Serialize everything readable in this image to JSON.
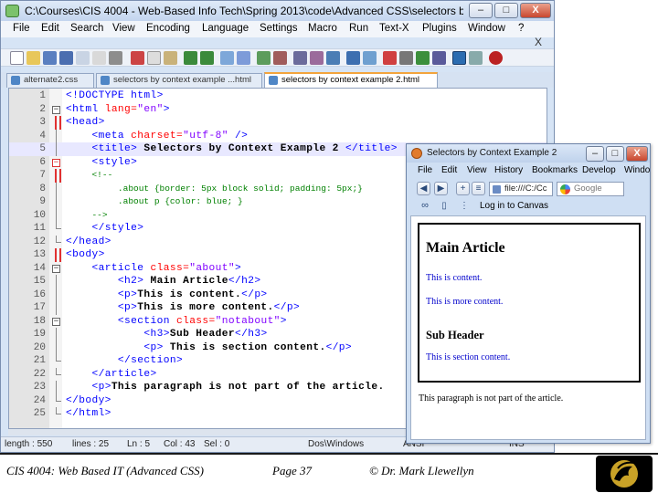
{
  "notepad": {
    "title": "C:\\Courses\\CIS 4004 - Web-Based Info Tech\\Spring 2013\\code\\Advanced CSS\\selectors by con...",
    "window_buttons": {
      "minimize": "–",
      "maximize": "□",
      "close": "X"
    },
    "menu": [
      "File",
      "Edit",
      "Search",
      "View",
      "Encoding",
      "Language",
      "Settings",
      "Macro",
      "Run",
      "Text-X",
      "Plugins",
      "Window",
      "?"
    ],
    "doc_close": "X",
    "tabs": [
      {
        "label": "alternate2.css"
      },
      {
        "label": "selectors by context example ...html"
      },
      {
        "label": "selectors by context example 2.html"
      }
    ],
    "lines": [
      {
        "num": "1"
      },
      {
        "num": "2"
      },
      {
        "num": "3"
      },
      {
        "num": "4"
      },
      {
        "num": "5"
      },
      {
        "num": "6"
      },
      {
        "num": "7"
      },
      {
        "num": "8"
      },
      {
        "num": "9"
      },
      {
        "num": "10"
      },
      {
        "num": "11"
      },
      {
        "num": "12"
      },
      {
        "num": "13"
      },
      {
        "num": "14"
      },
      {
        "num": "15"
      },
      {
        "num": "16"
      },
      {
        "num": "17"
      },
      {
        "num": "18"
      },
      {
        "num": "19"
      },
      {
        "num": "20"
      },
      {
        "num": "21"
      },
      {
        "num": "22"
      },
      {
        "num": "23"
      },
      {
        "num": "24"
      },
      {
        "num": "25"
      }
    ],
    "code": {
      "l1": "<!DOCTYPE html>",
      "l2_tag": "<html",
      "l2_attr": "lang=",
      "l2_str": "\"en\"",
      "l2_end": ">",
      "l3": "<head>",
      "l4_tag": "<meta",
      "l4_attr": "charset=",
      "l4_str": "\"utf-8\"",
      "l4_end": "/>",
      "l5_open": "<title>",
      "l5_text": "Selectors by Context Example 2",
      "l5_close": "</title>",
      "l6": "<style>",
      "l7": "<!--",
      "l8": ".about {border: 5px block solid; padding: 5px;}",
      "l9": ".about p {color: blue; }",
      "l10": "-->",
      "l11": "</style>",
      "l12": "</head>",
      "l13": "<body>",
      "l14_tag": "<article",
      "l14_attr": "class=",
      "l14_str": "\"about\"",
      "l14_end": ">",
      "l15_open": "<h2>",
      "l15_text": "Main Article",
      "l15_close": "</h2>",
      "l16_open": "<p>",
      "l16_text": "This is content.",
      "l16_close": "</p>",
      "l17_open": "<p>",
      "l17_text": "This is more content.",
      "l17_close": "</p>",
      "l18_tag": "<section",
      "l18_attr": "class=",
      "l18_str": "\"notabout\"",
      "l18_end": ">",
      "l19_open": "<h3>",
      "l19_text": "Sub Header",
      "l19_close": "</h3>",
      "l20_open": "<p>",
      "l20_text": "This is section content.",
      "l20_close": "</p>",
      "l21": "</section>",
      "l22": "</article>",
      "l23_open": "<p>",
      "l23_text": "This paragraph is not part of the article.",
      "l24": "</body>",
      "l25": "</html>"
    },
    "status": {
      "length": "length : 550",
      "lines": "lines : 25",
      "ln": "Ln : 5",
      "col": "Col : 43",
      "sel": "Sel : 0",
      "eol": "Dos\\Windows",
      "enc": "ANSI",
      "ins": "INS"
    }
  },
  "firefox": {
    "title": "Selectors by Context Example 2",
    "window_buttons": {
      "minimize": "–",
      "maximize": "□",
      "close": "X"
    },
    "menu": [
      "File",
      "Edit",
      "View",
      "History",
      "Bookmarks",
      "Develop",
      "Windo"
    ],
    "url": "file:///C:/Cc",
    "search_placeholder": "Google",
    "bookmark": "Log in to Canvas",
    "page": {
      "h2": "Main Article",
      "p1": "This is content.",
      "p2": "This is more content.",
      "h3": "Sub Header",
      "p3": "This is section content.",
      "outside": "This paragraph is not part of the article."
    }
  },
  "footer": {
    "course": "CIS 4004: Web Based IT (Advanced CSS)",
    "page": "Page 37",
    "author": "© Dr. Mark Llewellyn"
  }
}
